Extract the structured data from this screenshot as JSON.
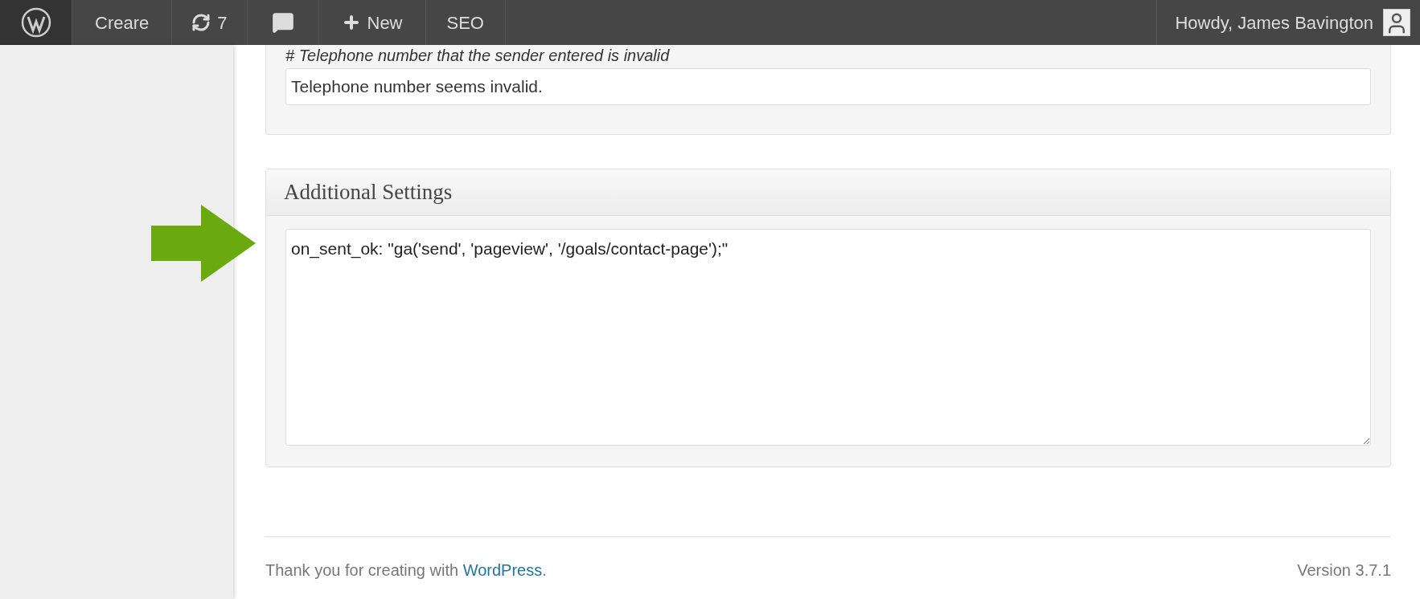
{
  "admin_bar": {
    "site": "Creare",
    "updates": "7",
    "new": "New",
    "seo": "SEO",
    "greeting": "Howdy, James Bavington"
  },
  "messages_box": {
    "hint": "# Telephone number that the sender entered is invalid",
    "value": "Telephone number seems invalid."
  },
  "additional_settings": {
    "title": "Additional Settings",
    "value": "on_sent_ok: \"ga('send', 'pageview', '/goals/contact-page');\""
  },
  "footer": {
    "text": "Thank you for creating with ",
    "link": "WordPress",
    "after": ".",
    "version": "Version 3.7.1"
  }
}
